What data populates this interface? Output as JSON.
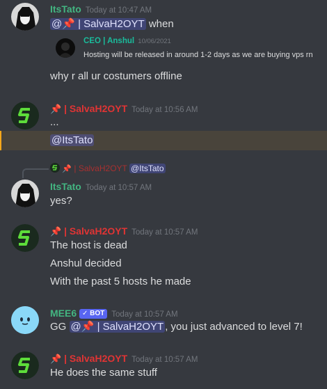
{
  "messages": {
    "m1": {
      "username": "ItsTato",
      "timestamp": "Today at 10:47 AM",
      "mention": "@📌 | SalvaH2OYT",
      "after_mention": "when",
      "embed": {
        "author": "CEO | Anshul",
        "date": "10/06/2021",
        "text": "Hosting will be released in around 1-2 days as we are buying vps rn"
      },
      "text2": "why r all ur costumers offline"
    },
    "m2": {
      "username": "| SalvaH2OYT",
      "timestamp": "Today at 10:56 AM",
      "text1": "...",
      "mention": "@ItsTato"
    },
    "reply": {
      "username": "| SalvaH2OYT",
      "mention": "@ItsTato"
    },
    "m3": {
      "username": "ItsTato",
      "timestamp": "Today at 10:57 AM",
      "text": "yes?"
    },
    "m4": {
      "username": "| SalvaH2OYT",
      "timestamp": "Today at 10:57 AM",
      "lines": [
        "The host is dead",
        "Anshul decided",
        "With the past 5 hosts he made"
      ]
    },
    "m5": {
      "username": "MEE6",
      "bot_label": "✓ BOT",
      "timestamp": "Today at 10:57 AM",
      "prefix": "GG",
      "mention": "@📌 | SalvaH2OYT",
      "suffix": ", you just advanced to level 7!"
    },
    "m6": {
      "username": "| SalvaH2OYT",
      "timestamp": "Today at 10:57 AM",
      "text": "He does the same stuff"
    }
  },
  "colors": {
    "background": "#36393f",
    "mention_bg": "#3d4270",
    "red_name": "#e03434",
    "green_name": "#43b581",
    "bot_tag": "#5865f2",
    "highlight_border": "#faa81a"
  }
}
